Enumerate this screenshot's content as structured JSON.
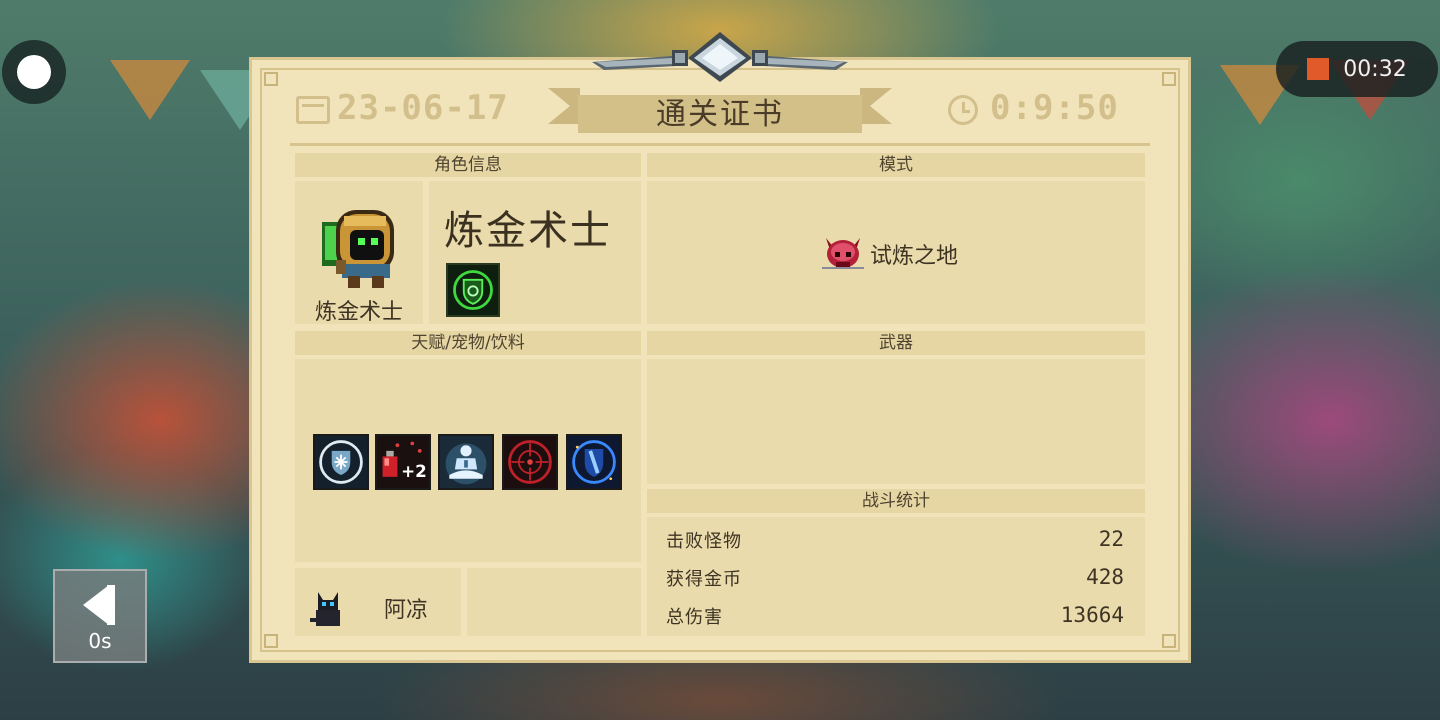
{
  "recording": {
    "time": "00:32"
  },
  "back_button": {
    "label": "0s"
  },
  "certificate": {
    "date": "23-06-17",
    "title": "通关证书",
    "duration": "0:9:50",
    "character_section": {
      "heading": "角色信息",
      "class_label": "炼金术士",
      "class_name": "炼金术士",
      "skill_icon": "green-shield-skill-icon"
    },
    "mode_section": {
      "heading": "模式",
      "mode_icon": "red-demon-skull-icon",
      "mode_name": "试炼之地"
    },
    "talents_section": {
      "heading": "天赋/宠物/饮料",
      "talents": [
        "ice-shield-talent-icon",
        "potion-plus-two-talent-icon",
        "meditating-figure-talent-icon",
        "red-crosshair-talent-icon",
        "blue-shield-slash-talent-icon"
      ],
      "pet": {
        "icon": "black-cat-icon",
        "name": "阿凉"
      }
    },
    "weapon_section": {
      "heading": "武器"
    },
    "battle_section": {
      "heading": "战斗统计",
      "stats": [
        {
          "label": "击败怪物",
          "value": "22"
        },
        {
          "label": "获得金币",
          "value": "428"
        },
        {
          "label": "总伤害",
          "value": "13664"
        }
      ]
    }
  },
  "colors": {
    "panel": "#f1e4bb",
    "section_header": "#e6d6a4",
    "box": "#e9dbab",
    "header_text": "#d2bf8c",
    "record_stop": "#e05a2a"
  }
}
